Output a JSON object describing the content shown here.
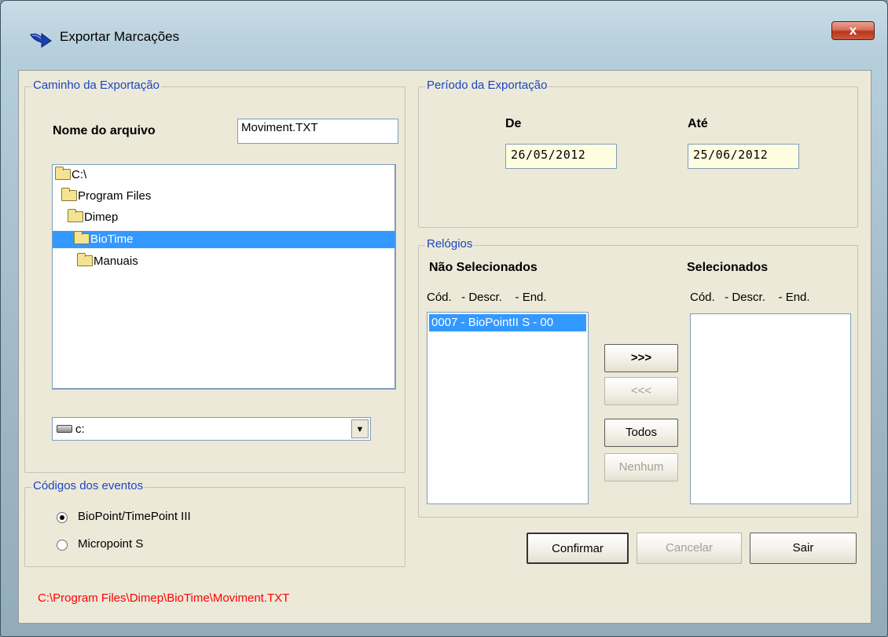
{
  "window": {
    "title": "Exportar Marcações",
    "close_label": "x"
  },
  "export_path": {
    "legend": "Caminho da Exportação",
    "filename_label": "Nome do arquivo",
    "filename_value": "Moviment.TXT",
    "tree": [
      {
        "label": "C:\\",
        "selected": false
      },
      {
        "label": "Program Files",
        "selected": false
      },
      {
        "label": "Dimep",
        "selected": false
      },
      {
        "label": "BioTime",
        "selected": true
      },
      {
        "label": "Manuais",
        "selected": false
      }
    ],
    "drive_value": "c:"
  },
  "event_codes": {
    "legend": "Códigos dos eventos",
    "options": [
      {
        "label": "BioPoint/TimePoint III",
        "checked": true
      },
      {
        "label": "Micropoint S",
        "checked": false
      }
    ]
  },
  "period": {
    "legend": "Período da Exportação",
    "from_label": "De",
    "from_value": "26/05/2012",
    "to_label": "Até",
    "to_value": "25/06/2012"
  },
  "clocks": {
    "legend": "Relógios",
    "unselected_title": "Não Selecionados",
    "unselected_header": "Cód.   - Descr.    - End.",
    "unselected_items": [
      "0007 - BioPointII S - 00"
    ],
    "selected_title": "Selecionados",
    "selected_header": "Cód.   - Descr.    - End.",
    "move_right_label": ">>>",
    "move_left_label": "<<<",
    "all_label": "Todos",
    "none_label": "Nenhum"
  },
  "actions": {
    "confirm_label": "Confirmar",
    "cancel_label": "Cancelar",
    "exit_label": "Sair"
  },
  "status": {
    "full_path": "C:\\Program Files\\Dimep\\BioTime\\Moviment.TXT",
    "color": "#ff0000"
  },
  "colors": {
    "selection": "#3399ff",
    "legend_text": "#1a46c0",
    "date_field_bg": "#fffde0"
  }
}
